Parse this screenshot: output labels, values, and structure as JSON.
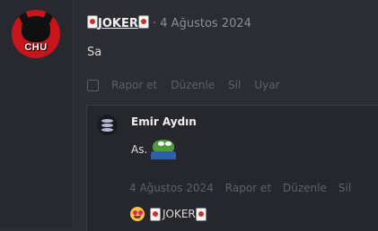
{
  "post": {
    "author": "JOKER",
    "separator": "·",
    "date": "4 Ağustos 2024",
    "body": "Sa",
    "actions": [
      "Rapor et",
      "Düzenle",
      "Sil",
      "Uyar"
    ],
    "avatar_text": "CHU"
  },
  "quote": {
    "author": "Emir Aydın",
    "body": "As.",
    "date": "4 Ağustos 2024",
    "actions": [
      "Rapor et",
      "Düzenle",
      "Sil"
    ]
  },
  "reaction": {
    "user": "JOKER"
  }
}
